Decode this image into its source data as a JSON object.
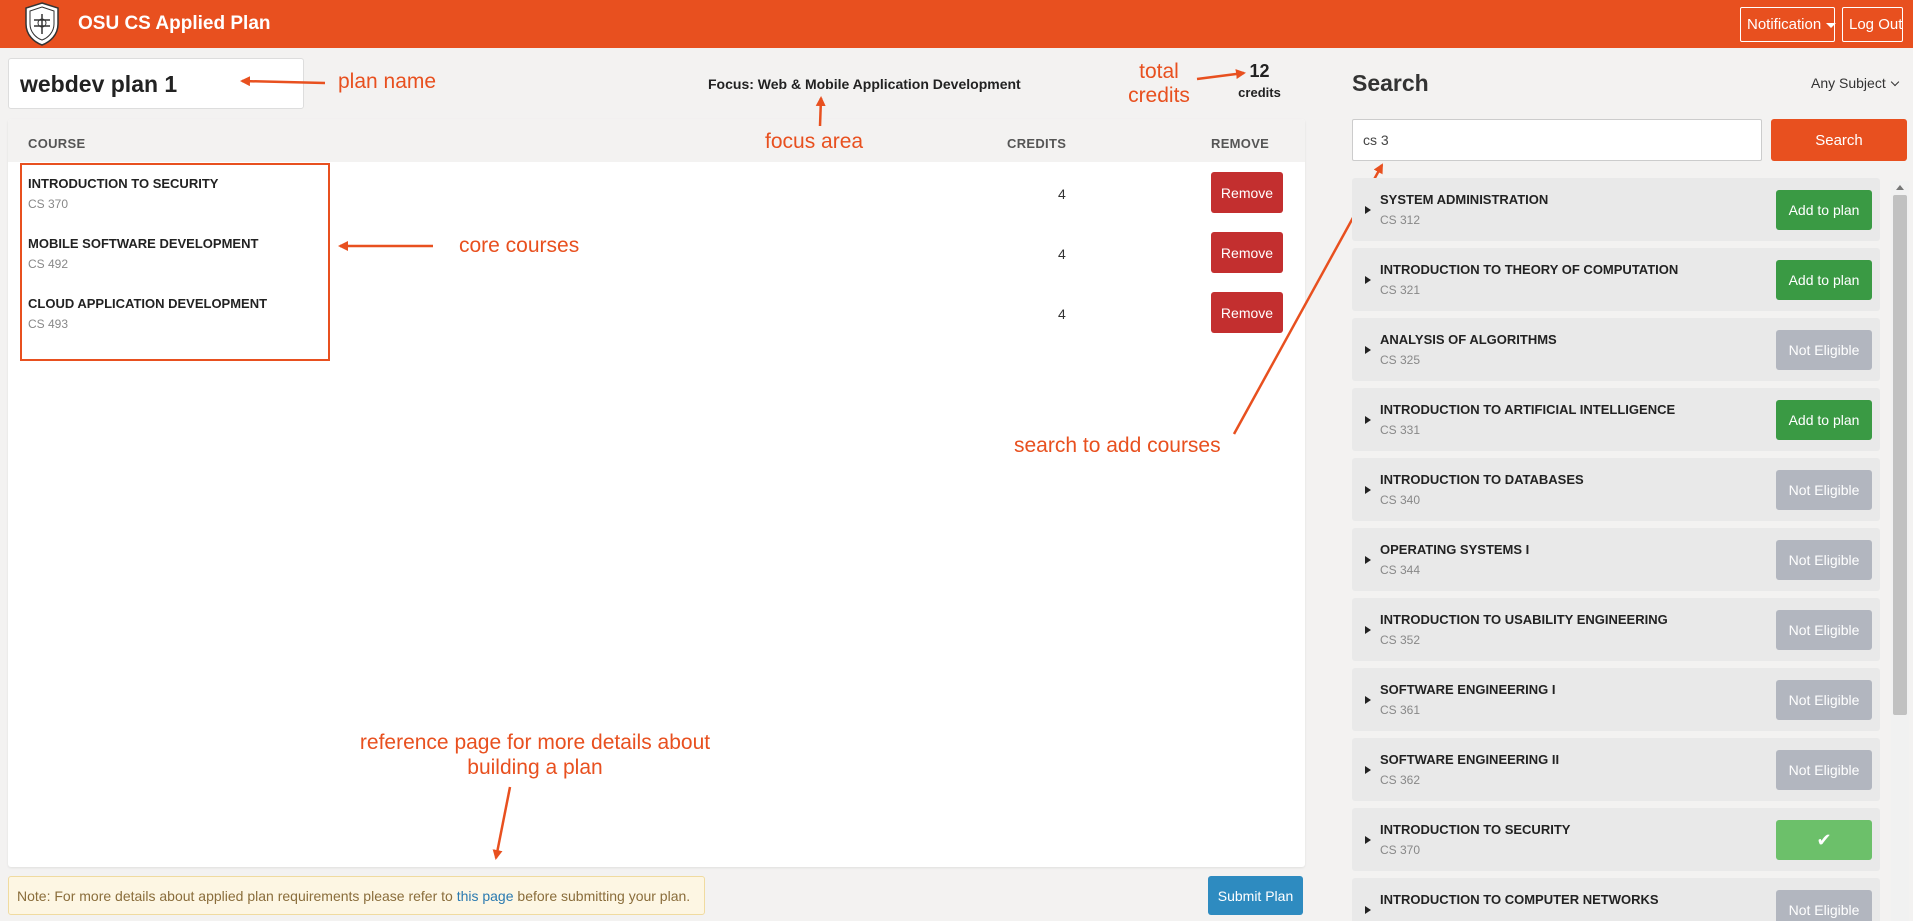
{
  "navbar": {
    "brand": "OSU CS Applied Plan",
    "notification_label": "Notification",
    "logout_label": "Log Out"
  },
  "plan": {
    "name": "webdev plan 1",
    "focus": "Focus: Web & Mobile Application Development",
    "total_credits": "12",
    "total_credits_label": "credits",
    "columns": {
      "course": "COURSE",
      "credits": "CREDITS",
      "remove": "REMOVE"
    },
    "courses": [
      {
        "title": "INTRODUCTION TO SECURITY",
        "code": "CS 370",
        "credits": "4",
        "action": "Remove"
      },
      {
        "title": "MOBILE SOFTWARE DEVELOPMENT",
        "code": "CS 492",
        "credits": "4",
        "action": "Remove"
      },
      {
        "title": "CLOUD APPLICATION DEVELOPMENT",
        "code": "CS 493",
        "credits": "4",
        "action": "Remove"
      }
    ],
    "note_before": "Note: For more details about applied plan requirements please refer to ",
    "note_link": "this page",
    "note_after": " before submitting your plan.",
    "submit_label": "Submit Plan"
  },
  "search": {
    "title": "Search",
    "subject": "Any Subject",
    "query": "cs 3",
    "button_label": "Search",
    "results": [
      {
        "title": "SYSTEM ADMINISTRATION",
        "code": "CS 312",
        "action": "Add to plan",
        "state": "add"
      },
      {
        "title": "INTRODUCTION TO THEORY OF COMPUTATION",
        "code": "CS 321",
        "action": "Add to plan",
        "state": "add"
      },
      {
        "title": "ANALYSIS OF ALGORITHMS",
        "code": "CS 325",
        "action": "Not Eligible",
        "state": "ne"
      },
      {
        "title": "INTRODUCTION TO ARTIFICIAL INTELLIGENCE",
        "code": "CS 331",
        "action": "Add to plan",
        "state": "add"
      },
      {
        "title": "INTRODUCTION TO DATABASES",
        "code": "CS 340",
        "action": "Not Eligible",
        "state": "ne"
      },
      {
        "title": "OPERATING SYSTEMS I",
        "code": "CS 344",
        "action": "Not Eligible",
        "state": "ne"
      },
      {
        "title": "INTRODUCTION TO USABILITY ENGINEERING",
        "code": "CS 352",
        "action": "Not Eligible",
        "state": "ne"
      },
      {
        "title": "SOFTWARE ENGINEERING I",
        "code": "CS 361",
        "action": "Not Eligible",
        "state": "ne"
      },
      {
        "title": "SOFTWARE ENGINEERING II",
        "code": "CS 362",
        "action": "Not Eligible",
        "state": "ne"
      },
      {
        "title": "INTRODUCTION TO SECURITY",
        "code": "CS 370",
        "action": "✔",
        "state": "done"
      },
      {
        "title": "INTRODUCTION TO COMPUTER NETWORKS",
        "code": "",
        "action": "Not Eligible",
        "state": "ne"
      }
    ]
  },
  "annotations": {
    "plan_name": "plan name",
    "focus_area": "focus area",
    "total_credits_1": "total",
    "total_credits_2": "credits",
    "core_courses": "core courses",
    "search_add": "search to add courses",
    "reference_1": "reference page for more details about",
    "reference_2": "building a plan"
  },
  "colors": {
    "brand": "#e8501f",
    "remove": "#c32f2f",
    "add": "#3a9a44",
    "not_eligible": "#b2b6bf",
    "submit": "#2e8bc0"
  },
  "icons": {
    "logo": "osu-seal-icon",
    "dropdown": "caret-down-icon",
    "expand": "triangle-right-icon",
    "added": "check-icon"
  }
}
